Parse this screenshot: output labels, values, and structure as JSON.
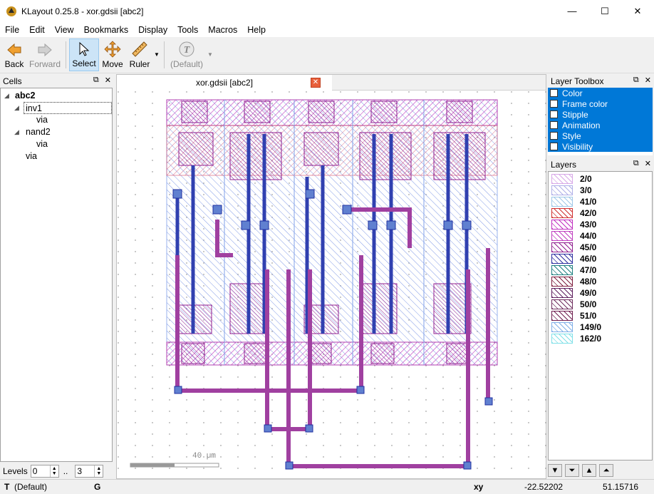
{
  "window": {
    "title": "KLayout 0.25.8 - xor.gdsii [abc2]",
    "minimize": "—",
    "maximize": "☐",
    "close": "✕"
  },
  "menu": [
    "File",
    "Edit",
    "View",
    "Bookmarks",
    "Display",
    "Tools",
    "Macros",
    "Help"
  ],
  "toolbar": {
    "back": "Back",
    "forward": "Forward",
    "select": "Select",
    "move": "Move",
    "ruler": "Ruler",
    "default": "(Default)"
  },
  "cells_panel": {
    "title": "Cells",
    "tree": [
      {
        "label": "abc2",
        "level": 0,
        "expanded": true,
        "bold": true
      },
      {
        "label": "inv1",
        "level": 1,
        "expanded": true,
        "selected": true
      },
      {
        "label": "via",
        "level": 2
      },
      {
        "label": "nand2",
        "level": 1,
        "expanded": true
      },
      {
        "label": "via",
        "level": 2
      },
      {
        "label": "via",
        "level": 1
      }
    ]
  },
  "levels": {
    "label": "Levels",
    "from": "0",
    "sep": "..",
    "to": "3"
  },
  "canvas": {
    "tab_title": "xor.gdsii [abc2]",
    "scale_label": "40 µm"
  },
  "layer_toolbox": {
    "title": "Layer Toolbox",
    "items": [
      "Color",
      "Frame color",
      "Stipple",
      "Animation",
      "Style",
      "Visibility"
    ]
  },
  "layers_panel": {
    "title": "Layers",
    "layers": [
      {
        "name": "2/0",
        "color": "#d8a8e8"
      },
      {
        "name": "3/0",
        "color": "#b0b0e8"
      },
      {
        "name": "41/0",
        "color": "#a0c8e8"
      },
      {
        "name": "42/0",
        "color": "#d03030"
      },
      {
        "name": "43/0",
        "color": "#c030c0"
      },
      {
        "name": "44/0",
        "color": "#c040c0"
      },
      {
        "name": "45/0",
        "color": "#902090"
      },
      {
        "name": "46/0",
        "color": "#3030a0"
      },
      {
        "name": "47/0",
        "color": "#208080"
      },
      {
        "name": "48/0",
        "color": "#802040"
      },
      {
        "name": "49/0",
        "color": "#602060"
      },
      {
        "name": "50/0",
        "color": "#703060"
      },
      {
        "name": "51/0",
        "color": "#702050"
      },
      {
        "name": "149/0",
        "color": "#80b0e8"
      },
      {
        "name": "162/0",
        "color": "#80e0e8"
      }
    ]
  },
  "status": {
    "mode_icon": "T",
    "mode": "(Default)",
    "grid": "G",
    "coord_label": "xy",
    "x": "-22.52202",
    "y": "51.15716"
  }
}
